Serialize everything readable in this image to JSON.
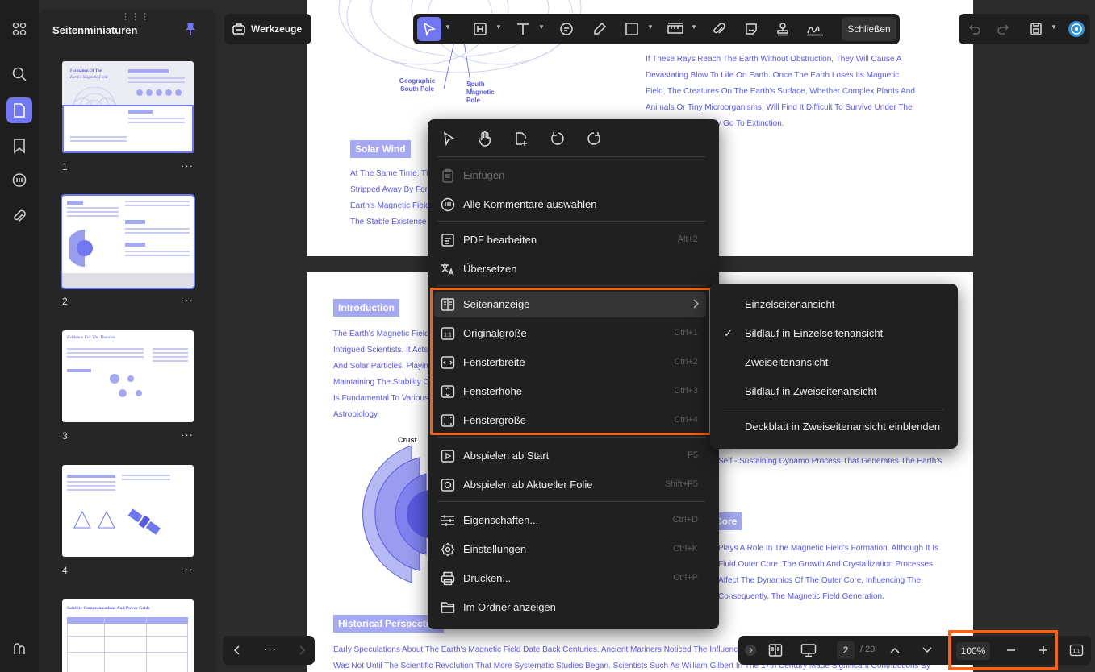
{
  "colors": {
    "accent": "#7177f0",
    "highlight": "#f2641c",
    "menu_bg": "#202020",
    "doc_text": "#5a5ae0"
  },
  "rail": {
    "icons": [
      "grid-icon",
      "search-icon",
      "page-icon",
      "bookmark-icon",
      "comment-icon",
      "attachment-icon",
      "layers-icon"
    ]
  },
  "thumbnails": {
    "title": "Seitenminiaturen",
    "drag_handle": "⋮⋮⋮",
    "pages": [
      {
        "number": "1",
        "heading_line1": "Formation Of The",
        "heading_line2": "Earth's Magnetic Field",
        "more": "···"
      },
      {
        "number": "2",
        "more": "···"
      },
      {
        "number": "3",
        "heading_line1": "Evidence For The Theories",
        "more": "···"
      },
      {
        "number": "4",
        "more": "···"
      },
      {
        "number": "5",
        "heading_line1": "Satellite Communications And Power Grids"
      }
    ]
  },
  "toolbar": {
    "tools_label": "Werkzeuge",
    "close_label": "Schließen"
  },
  "page1": {
    "label_geo": "Geographic South Pole",
    "label_mag": "South Magnetic Pole",
    "right_text": [
      "If These Rays Reach The Earth Without Obstruction, They Will Cause A",
      "Devastating Blow To Life On Earth. Once The Earth Loses Its Magnetic",
      "Field, The Creatures On The Earth's Surface, Whether Complex Plants And",
      "Animals Or Tiny Microorganisms, Will Find It Difficult To Survive Under The",
      "rays And Will Quickly Go To Extinction."
    ],
    "solar_heading": "Solar Wind",
    "solar_text": [
      "At The Same Time, The",
      "Stripped Away By Force",
      "Earth's Magnetic Field",
      "The Stable Existence O"
    ]
  },
  "page2": {
    "intro_heading": "Introduction",
    "intro_text": [
      "The Earth's Magnetic Field,",
      "Intrigued Scientists. It Acts A",
      "And Solar Particles, Playing",
      "Maintaining The Stability Of",
      "Is Fundamental To Various",
      "Astrobiology."
    ],
    "crust_label": "Crust",
    "dynamo_text": "Self - Sustaining Dynamo Process That Generates The Earth's",
    "core_heading": "Core",
    "core_text": [
      "Plays A Role In The Magnetic Field's Formation. Although It Is",
      "Fluid Outer Core. The Growth And Crystallization Processes",
      "Affect The Dynamics Of The Outer Core, Influencing The",
      "Consequently, The Magnetic Field Generation."
    ],
    "history_heading": "Historical Perspective",
    "history_text": [
      "Early Speculations About The Earth's Magnetic Field Date Back Centuries. Ancient Mariners Noticed The Influence Of Th",
      "Was Not Until The Scientific Revolution That More Systematic Studies Began. Scientists Such As William Gilbert In The 17th Century Made Significant Contributions By"
    ]
  },
  "context_menu": {
    "quick_icons": [
      "pointer-icon",
      "hand-icon",
      "add-page-icon",
      "rotate-left-icon",
      "rotate-right-icon"
    ],
    "items": [
      {
        "label": "Einfügen",
        "shortcut": "",
        "disabled": true,
        "icon": "paste-icon"
      },
      {
        "label": "Alle Kommentare auswählen",
        "shortcut": "",
        "icon": "select-comments-icon"
      },
      {
        "label": "PDF bearbeiten",
        "shortcut": "Alt+2",
        "icon": "edit-pdf-icon"
      },
      {
        "label": "Übersetzen",
        "shortcut": "",
        "icon": "translate-icon"
      },
      {
        "label": "Seitenanzeige",
        "shortcut": "",
        "icon": "page-display-icon",
        "submenu": true
      },
      {
        "label": "Originalgröße",
        "shortcut": "Ctrl+1",
        "icon": "original-size-icon"
      },
      {
        "label": "Fensterbreite",
        "shortcut": "Ctrl+2",
        "icon": "fit-width-icon"
      },
      {
        "label": "Fensterhöhe",
        "shortcut": "Ctrl+3",
        "icon": "fit-height-icon"
      },
      {
        "label": "Fenstergröße",
        "shortcut": "Ctrl+4",
        "icon": "fit-window-icon"
      },
      {
        "label": "Abspielen ab Start",
        "shortcut": "F5",
        "icon": "play-start-icon"
      },
      {
        "label": "Abspielen ab Aktueller Folie",
        "shortcut": "Shift+F5",
        "icon": "play-current-icon"
      },
      {
        "label": "Eigenschaften...",
        "shortcut": "Ctrl+D",
        "icon": "properties-icon"
      },
      {
        "label": "Einstellungen",
        "shortcut": "Ctrl+K",
        "icon": "settings-icon"
      },
      {
        "label": "Drucken...",
        "shortcut": "Ctrl+P",
        "icon": "print-icon"
      },
      {
        "label": "Im Ordner anzeigen",
        "shortcut": "",
        "icon": "folder-icon"
      }
    ]
  },
  "submenu": {
    "items": [
      {
        "label": "Einzelseitenansicht",
        "checked": false
      },
      {
        "label": "Bildlauf in Einzelseitenansicht",
        "checked": true
      },
      {
        "label": "Zweiseitenansicht",
        "checked": false
      },
      {
        "label": "Bildlauf in Zweiseitenansicht",
        "checked": false
      },
      {
        "label": "Deckblatt in Zweiseitenansicht einblenden",
        "checked": false
      }
    ],
    "check_mark": "✓"
  },
  "bottom": {
    "more_label": "···",
    "current_page": "2",
    "total_pages": "/ 29",
    "zoom": "100%"
  }
}
